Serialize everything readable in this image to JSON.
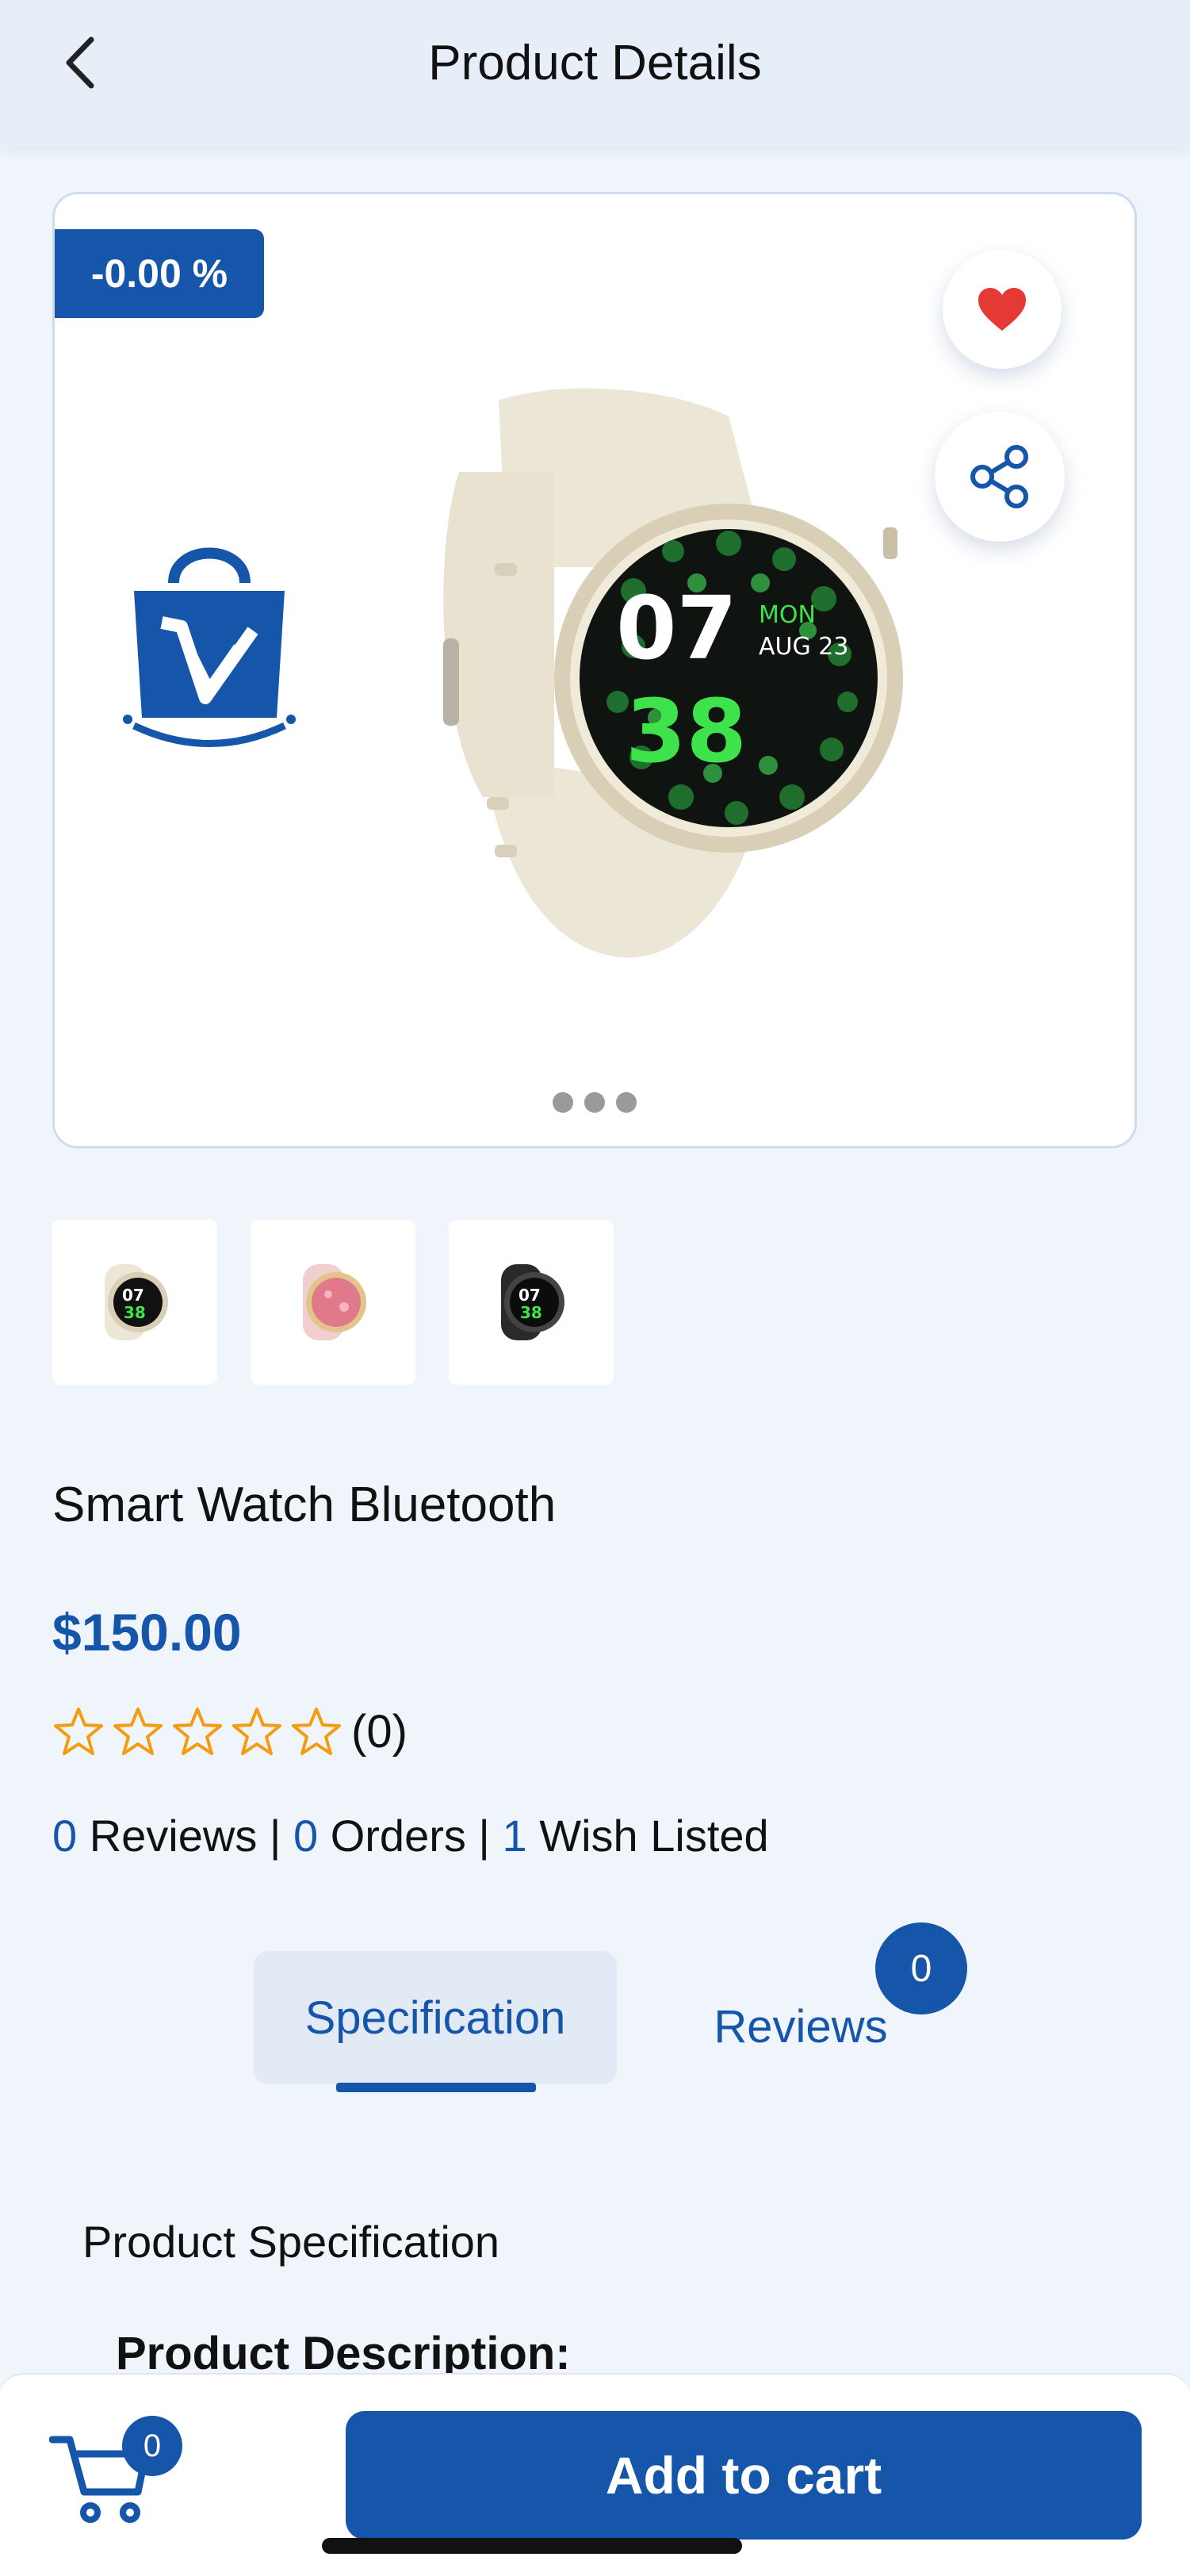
{
  "header": {
    "title": "Product Details",
    "back_icon": "chevron-left-icon"
  },
  "gallery": {
    "discount_badge": "-0.00 %",
    "wishlist_icon": "heart-icon",
    "share_icon": "share-icon",
    "dot_count": 3,
    "thumbnails": [
      "cream-watch",
      "pink-watch",
      "black-watch"
    ]
  },
  "product": {
    "name": "Smart Watch Bluetooth",
    "price": "$150.00",
    "rating_stars": 0,
    "rating_count": "(0)",
    "reviews_count": "0",
    "reviews_label": " Reviews | ",
    "orders_count": "0",
    "orders_label": " Orders | ",
    "wishlist_count": "1",
    "wishlist_label": " Wish Listed"
  },
  "tabs": {
    "specification": "Specification",
    "reviews": "Reviews",
    "reviews_badge": "0"
  },
  "content": {
    "spec_heading": "Product Specification",
    "description_heading": "Product Description:"
  },
  "bottom_bar": {
    "cart_badge": "0",
    "add_to_cart": "Add to cart"
  },
  "colors": {
    "brand": "#1555aa",
    "heart": "#e53935",
    "star": "#f39c12"
  }
}
